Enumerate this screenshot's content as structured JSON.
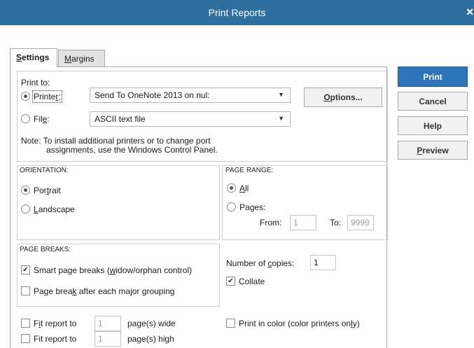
{
  "window": {
    "title": "Print Reports"
  },
  "icons": {
    "close": "close-icon",
    "dropdown": "chevron-down-icon",
    "checkmark": "checkmark-icon"
  },
  "tabs": [
    {
      "label": "Settings",
      "mnemonic": "S",
      "rest": "ettings",
      "active": true
    },
    {
      "label": "Margins",
      "mnemonic": "M",
      "rest": "argins",
      "active": false
    }
  ],
  "print_to": {
    "label": "Print to:",
    "printer": {
      "pre": "Printe",
      "mnemonic": "r",
      "post": ":",
      "selected": true,
      "value": "Send To OneNote 2013 on nul:"
    },
    "file": {
      "pre": "Fil",
      "mnemonic": "e",
      "post": ":",
      "selected": false,
      "value": "ASCII text file"
    },
    "options": {
      "mnemonic": "O",
      "rest": "ptions..."
    },
    "note_line1": "Note: To install additional printers or to change port",
    "note_line2": "assignments, use the Windows Control Panel."
  },
  "orientation": {
    "title": "ORIENTATION:",
    "portrait": {
      "pre": "Por",
      "mnemonic": "t",
      "post": "rait",
      "selected": true
    },
    "landscape": {
      "pre": "",
      "mnemonic": "L",
      "post": "andscape",
      "selected": false
    }
  },
  "page_range": {
    "title": "PAGE RANGE:",
    "all": {
      "pre": "",
      "mnemonic": "A",
      "post": "ll",
      "selected": true
    },
    "pages": {
      "pre": "Pa",
      "mnemonic": "g",
      "post": "es:",
      "selected": false
    },
    "from_label": "From:",
    "from_value": "1",
    "to_label": "To:",
    "to_value": "9999"
  },
  "page_breaks": {
    "title": "PAGE BREAKS:",
    "smart": {
      "pre": "Smart page breaks (",
      "mnemonic": "w",
      "post": "idow/orphan control)",
      "checked": true
    },
    "major": {
      "pre": "Page brea",
      "mnemonic": "k",
      "post": " after each major grouping",
      "checked": false
    }
  },
  "copies": {
    "pre": "Number of ",
    "mnemonic": "c",
    "post": "opies:",
    "value": "1"
  },
  "collate": {
    "label": "Collate",
    "checked": true
  },
  "fit_wide": {
    "pre": "F",
    "mnemonic": "i",
    "post": "t report to",
    "value": "1",
    "suffix": "page(s) wide",
    "checked": false
  },
  "fit_high": {
    "label": "Fit report to",
    "value": "1",
    "suffix": "page(s) high",
    "checked": false
  },
  "color": {
    "label": "Print in color (color printers only)",
    "pre": "Print in color (color printers on",
    "mnemonic": "l",
    "post": "y)",
    "checked": false
  },
  "buttons": {
    "print": "Print",
    "cancel": "Cancel",
    "help": "Help",
    "preview": {
      "mnemonic": "P",
      "rest": "review"
    }
  }
}
